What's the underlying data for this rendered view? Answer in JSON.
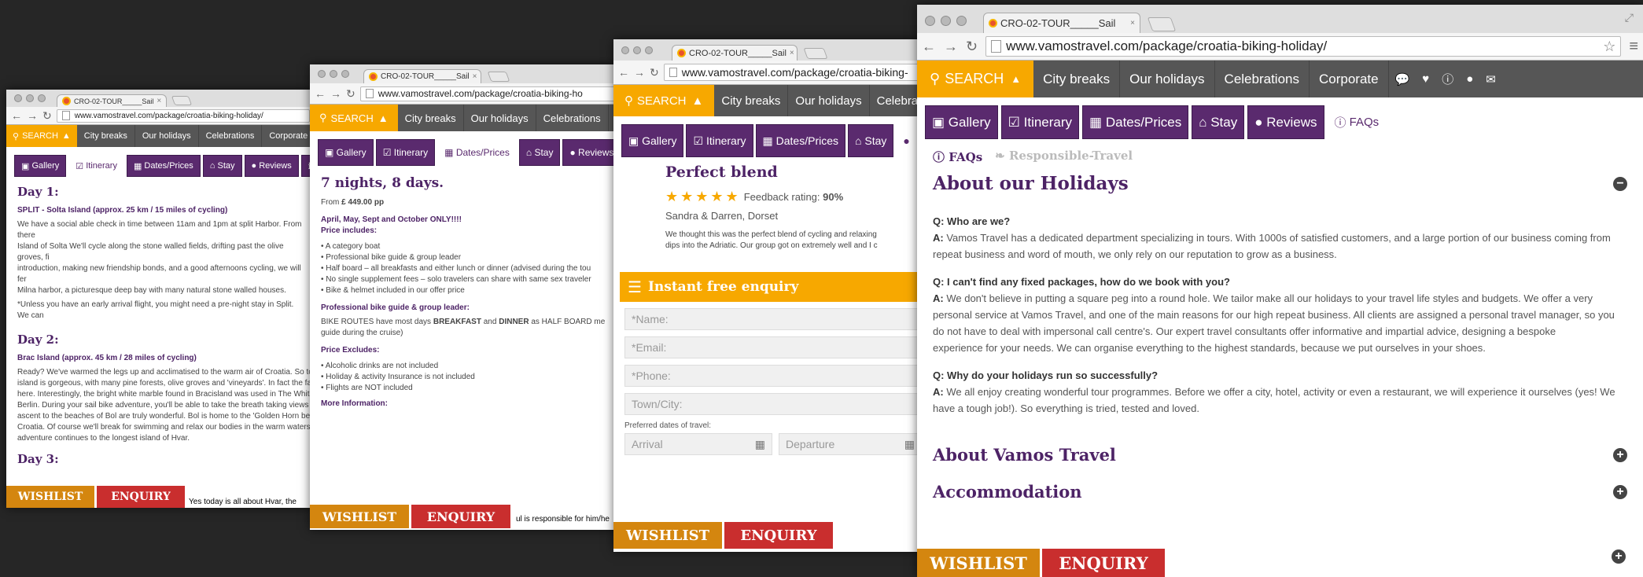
{
  "browser": {
    "tab_title": "CRO-02-TOUR_____Sail",
    "url_short": "www.vamostravel.com/package/croatia-biking-holiday/",
    "url_w2": "www.vamostravel.com/package/croatia-biking-ho",
    "url_w3": "www.vamostravel.com/package/croatia-biking-",
    "url_w4": "www.vamostravel.com/package/croatia-biking-holiday/",
    "tab_close": "×"
  },
  "menu": {
    "search_label": "SEARCH",
    "items": [
      "City breaks",
      "Our holidays",
      "Celebrations",
      "Corporate"
    ],
    "icons": [
      "comment-icon",
      "heart-icon",
      "info-icon",
      "user-icon",
      "envelope-icon"
    ]
  },
  "package_tabs": [
    "Gallery",
    "Itinerary",
    "Dates/Prices",
    "Stay",
    "Reviews",
    "FAQs"
  ],
  "buttons": {
    "wishlist": "WISHLIST",
    "enquiry": "ENQUIRY"
  },
  "window1": {
    "day1_title": "Day 1:",
    "day1_sub": "SPLIT - Solta Island (approx. 25 km / 15 miles of cycling)",
    "day1_p1": "We have a social able check in time between 11am and 1pm at split Harbor. From there",
    "day1_p2": "Island of Solta We'll cycle along the stone walled fields, drifting past the olive groves, fi",
    "day1_p3": "introduction, making new friendship bonds, and a good afternoons cycling, we will fer",
    "day1_p4": "Milna harbor, a picturesque deep bay with many natural stone walled houses.",
    "day1_note": "*Unless you have an early arrival flight, you might need a pre-night stay in Split. We can",
    "day2_title": "Day 2:",
    "day2_sub": "Brac Island (approx. 45 km / 28 miles of cycling)",
    "day2_lines": [
      "Ready? We've warmed the legs up and acclimatised to the warm air of Croatia. So toda",
      "island is gorgeous, with many pine forests, olive groves and 'vineyards'. In fact the fam",
      "here. Interestingly, the bright white marble found in Bracisland was used in The White",
      "Berlin. During your sail bike adventure, you'll be able to take the breath taking views of",
      "ascent to the beaches of Bol are truly wonderful. Bol is home to the 'Golden Horn beac",
      "Croatia. Of course we'll break for swimming and relax our bodies in the warm waters o",
      "adventure continues to the longest island of Hvar."
    ],
    "day3_title": "Day 3:",
    "day3_peek": "Yes today is all about Hvar, the islan"
  },
  "window2": {
    "heading": "7 nights, 8 days.",
    "from_label": "From",
    "price": "£ 449.00 pp",
    "months": "April, May, Sept and October ONLY!!!!",
    "includes_label": "Price includes:",
    "includes": [
      "• A category boat",
      "• Professional bike guide & group leader",
      "• Half board – all breakfasts and either lunch or dinner (advised during the tou",
      "• No single supplement fees – solo travelers can share with same sex traveler",
      "• Bike & helmet included in our offer price"
    ],
    "guide_label": "Professional bike guide & group leader:",
    "guide_text_1": "BIKE ROUTES have most days",
    "guide_breakfast": "BREAKFAST",
    "guide_and": "and",
    "guide_dinner": "DINNER",
    "guide_text_2": "as HALF BOARD me",
    "guide_text_3": "guide during the cruise)",
    "excludes_label": "Price Excludes:",
    "excludes": [
      "• Alcoholic drinks are not included",
      "• Holiday & activity Insurance is not included",
      "• Flights are NOT included"
    ],
    "more_label": "More Information:",
    "more_peek": "ul is responsible for him/he"
  },
  "window3": {
    "review_title": "Perfect blend",
    "feedback_label": "Feedback rating:",
    "feedback_value": "90%",
    "stars": 5,
    "reviewer": "Sandra & Darren, Dorset",
    "review_l1": "We thought this was the perfect blend of cycling and relaxing",
    "review_l2": "dips into the Adriatic. Our group got on extremely well and I c",
    "enquiry_title": "Instant free enquiry",
    "fields": [
      "*Name:",
      "*Email:",
      "*Phone:",
      "Town/City:"
    ],
    "dates_label": "Preferred dates of travel:",
    "arrival": "Arrival",
    "departure": "Departure"
  },
  "window4": {
    "faq_tab": "FAQs",
    "responsible_tab": "Responsible-Travel",
    "section_title": "About our Holidays",
    "q1": "Q: Who are we?",
    "a1_label": "A:",
    "a1_l1": "Vamos Travel has a dedicated department specializing in tours. With 1000s of satisfied customers, and a large portion of our business coming from",
    "a1_l2": "repeat business and word of mouth, we only rely on our reputation to grow as a business.",
    "q2": "Q: I can't find any fixed packages, how do we book with you?",
    "a2_l1": "We don't believe in putting a square peg into a round hole. We tailor make all our holidays to your travel life styles and budgets. We offer a very",
    "a2_l2": "personal service at Vamos Travel, and one of the main reasons for our high repeat business. All clients are assigned a personal travel manager, so you",
    "a2_l3": "do not have to deal with impersonal call centre's. Our expert travel consultants offer informative and impartial advice, designing a bespoke",
    "a2_l4": "experience for your needs. We can organise everything to the highest standards, because we put ourselves in your shoes.",
    "q3": "Q: Why do your holidays run so successfully?",
    "a3_l1": "We all enjoy creating wonderful tour programmes. Before we offer a city, hotel, activity or even a restaurant, we will experience it ourselves (yes! We",
    "a3_l2": "have a tough job!). So everything is tried, tested and loved.",
    "about_vamos": "About Vamos Travel",
    "accommodation": "Accommodation"
  }
}
